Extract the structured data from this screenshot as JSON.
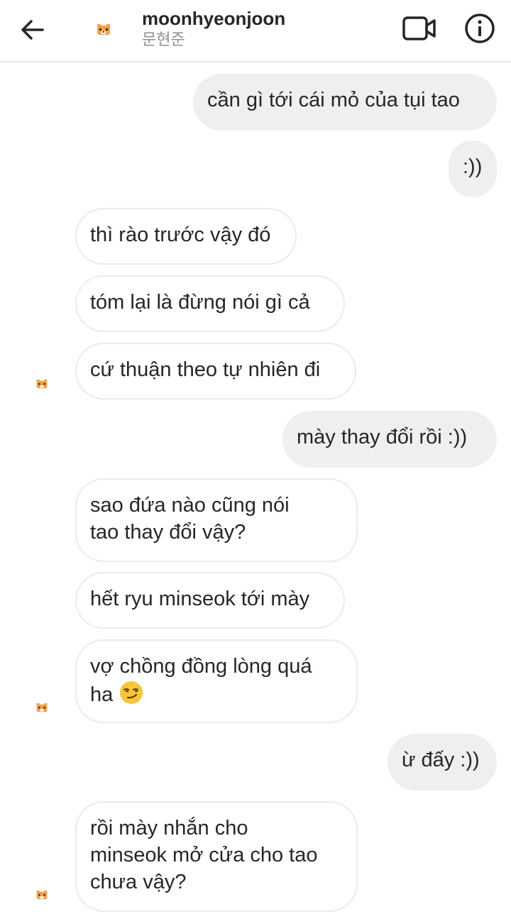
{
  "header": {
    "username": "moonhyeonjoon",
    "subname": "문현준"
  },
  "messages": [
    {
      "dir": "out",
      "text": "cần gì tới cái mỏ của tụi tao"
    },
    {
      "dir": "out",
      "text": ":))"
    },
    {
      "dir": "in",
      "text": "thì rào trước vậy đó"
    },
    {
      "dir": "in",
      "text": "tóm lại là đừng nói gì cả"
    },
    {
      "dir": "in",
      "text": "cứ thuận theo tự nhiên đi"
    },
    {
      "dir": "out",
      "text": "mày thay đổi rồi :))"
    },
    {
      "dir": "in",
      "text": "sao đứa nào cũng nói\ntao thay đổi vậy?"
    },
    {
      "dir": "in",
      "text": "hết ryu minseok tới mày"
    },
    {
      "dir": "in",
      "text": "vợ chồng đồng lòng quá\nha",
      "emoji": "smirk-emoji"
    },
    {
      "dir": "out",
      "text": "ừ đấy :))"
    },
    {
      "dir": "in",
      "text": "rồi mày nhắn cho\nminseok mở cửa cho tao\nchưa vậy?"
    }
  ]
}
